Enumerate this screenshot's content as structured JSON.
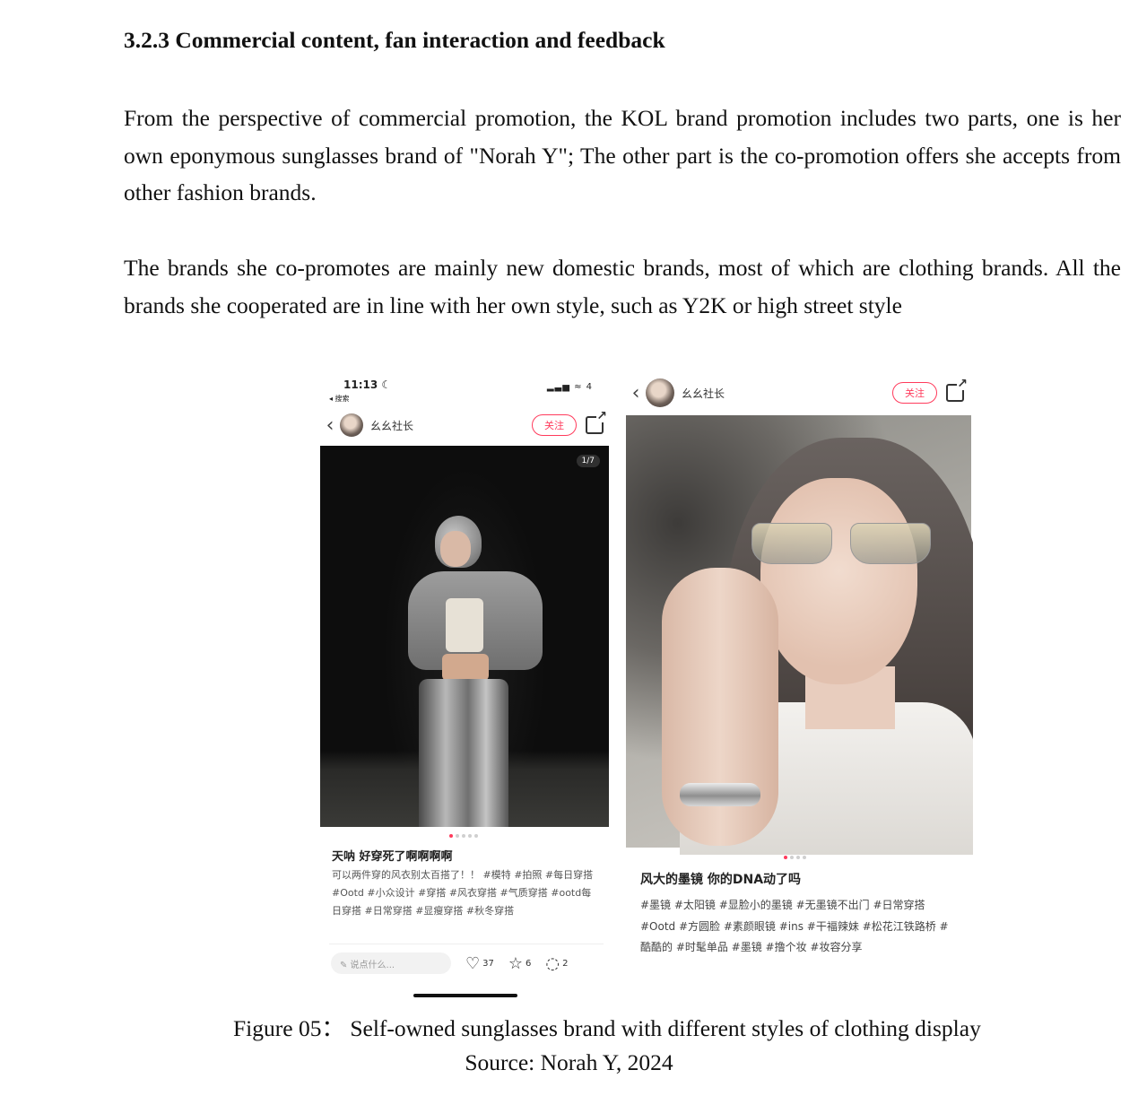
{
  "heading": "3.2.3 Commercial content, fan interaction and feedback",
  "paragraphs": [
    "From the perspective of commercial promotion, the KOL brand promotion includes two parts, one is her own eponymous sunglasses brand of \"Norah Y\"; The other part is the co-promotion offers she accepts from other fashion brands.",
    "The brands she co-promotes are mainly new domestic brands, most of which are clothing brands. All the brands she cooperated are in line with her own style, such as Y2K or high street style"
  ],
  "left_post": {
    "status_time": "11:13 ☾",
    "status_back": "◂ 搜索",
    "status_icons": "▂▃▅ ≈ 4",
    "username": "幺幺社长",
    "follow_label": "关注",
    "image_counter": "1/7",
    "title": "天呐 好穿死了啊啊啊啊",
    "body": "可以两件穿的风衣别太百搭了！！ #模特 #拍照 #每日穿搭 #Ootd #小众设计 #穿搭 #风衣穿搭 #气质穿搭 #ootd每日穿搭 #日常穿搭 #显瘦穿搭 #秋冬穿搭",
    "comment_placeholder": "✎ 说点什么...",
    "likes": "37",
    "favorites": "6",
    "comments": "2"
  },
  "right_post": {
    "username": "幺幺社长",
    "follow_label": "关注",
    "title": "风大的墨镜 你的DNA动了吗",
    "body": "#墨镜 #太阳镜 #显脸小的墨镜 #无墨镜不出门 #日常穿搭\n#Ootd #方圆脸 #素颜眼镜 #ins #干褔辣妹 #松花江铁路桥 #酷酷的 #时髦单品 #墨镜 #撸个妆 #妆容分享"
  },
  "caption": "Figure 05：  Self-owned sunglasses brand with different styles of clothing display",
  "source": "Source: Norah Y, 2024",
  "colors": {
    "accent": "#ff3b5c"
  }
}
